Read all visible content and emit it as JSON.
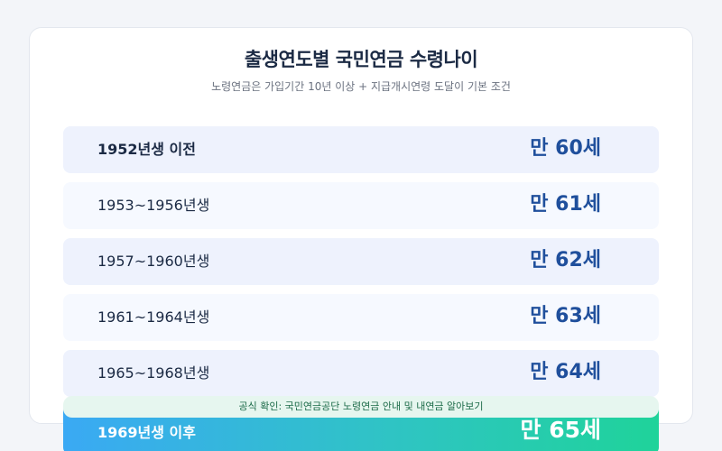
{
  "header": {
    "title": "출생연도별 국민연금 수령나이",
    "subtitle": "노령연금은 가입기간 10년 이상 + 지급개시연령 도달이 기본 조건"
  },
  "table": {
    "rows": [
      {
        "birth": "1952년생 이전",
        "age": "만 60세"
      },
      {
        "birth": "1953~1956년생",
        "age": "만 61세"
      },
      {
        "birth": "1957~1960년생",
        "age": "만 62세"
      },
      {
        "birth": "1961~1964년생",
        "age": "만 63세"
      },
      {
        "birth": "1965~1968년생",
        "age": "만 64세"
      },
      {
        "birth": "1969년생 이후",
        "age": "만 65세"
      }
    ]
  },
  "notice": {
    "text": "공식 확인: 국민연금공단 노령연금 안내 및 내연금 알아보기"
  },
  "colors": {
    "title": "#1b2a44",
    "age_text": "#1f4f9c",
    "highlight_start": "#3aa9f4",
    "highlight_end": "#1fd39a",
    "notice_bg": "#e6f6ef",
    "notice_text": "#1c6b49"
  }
}
